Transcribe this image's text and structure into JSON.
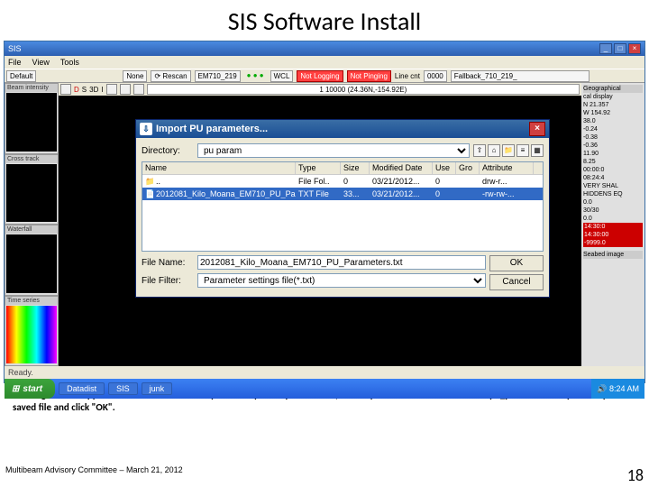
{
  "slide": {
    "title": "SIS Software Install",
    "caption": "A dialog box will appear.  Browse to the location you saved you PU parameters (normally in the E: /sisdata/common/pu_param directory. Select your saved file and click \"OK\".",
    "footer": "Multibeam Advisory Committee – March 21, 2012",
    "page": "18"
  },
  "window": {
    "title": "SIS",
    "menus": [
      "File",
      "View",
      "Tools"
    ],
    "status": "Ready.",
    "toolbar": {
      "default": "Default",
      "none": "None",
      "rescan": "Rescan",
      "em": "EM710_219",
      "wcl": "WCL",
      "not_logging": "Not Logging",
      "not_pinging": "Not Pinging",
      "line_cnt": "Line cnt",
      "line_val": "0000",
      "fallback": "Fallback_710_219_",
      "dots": "● ● ●"
    },
    "tb2_text": "1 10000 (24.36N,-154.92E)"
  },
  "panels": {
    "p1": "Beam intensity",
    "p2": "Cross track",
    "p3": "Waterfall",
    "p4": "Time series",
    "right_header": "Geographical",
    "right_display": "cal display",
    "right_lines": [
      "N 21.357",
      "W 154.92",
      "38.0",
      "-0.24",
      "-0.38",
      "-0.36",
      "11.90",
      "8.25",
      "00:00:0",
      "08:24:4",
      "",
      "VERY SHAL",
      "HIDDENS EQ",
      "0.0",
      "30/30",
      "0.0"
    ],
    "right_red": [
      "14:30:0",
      "14:30:00",
      "-9999.0"
    ],
    "seabed": "Seabed image"
  },
  "dialog": {
    "title": "Import PU parameters...",
    "dir_label": "Directory:",
    "dir_value": "pu param",
    "cols": [
      "Name",
      "Type",
      "Size",
      "Modified Date",
      "Use",
      "Gro",
      "Attribute"
    ],
    "row_up": {
      "name": "..",
      "type": "File Fol..",
      "size": "0",
      "mod": "03/21/2012...",
      "use": "0",
      "gro": "",
      "attr": "drw-r..."
    },
    "row_sel": {
      "name": "2012081_Kilo_Moana_EM710_PU_Parameters.txt",
      "type": "TXT File",
      "size": "33...",
      "mod": "03/21/2012...",
      "use": "0",
      "gro": "",
      "attr": "-rw-rw-..."
    },
    "fname_label": "File Name:",
    "fname_value": "2012081_Kilo_Moana_EM710_PU_Parameters.txt",
    "filter_label": "File Filter:",
    "filter_value": "Parameter settings file(*.txt)",
    "ok": "OK",
    "cancel": "Cancel"
  },
  "taskbar": {
    "start": "start",
    "items": [
      "Datadist",
      "SIS",
      "junk"
    ],
    "time": "8:24 AM"
  }
}
